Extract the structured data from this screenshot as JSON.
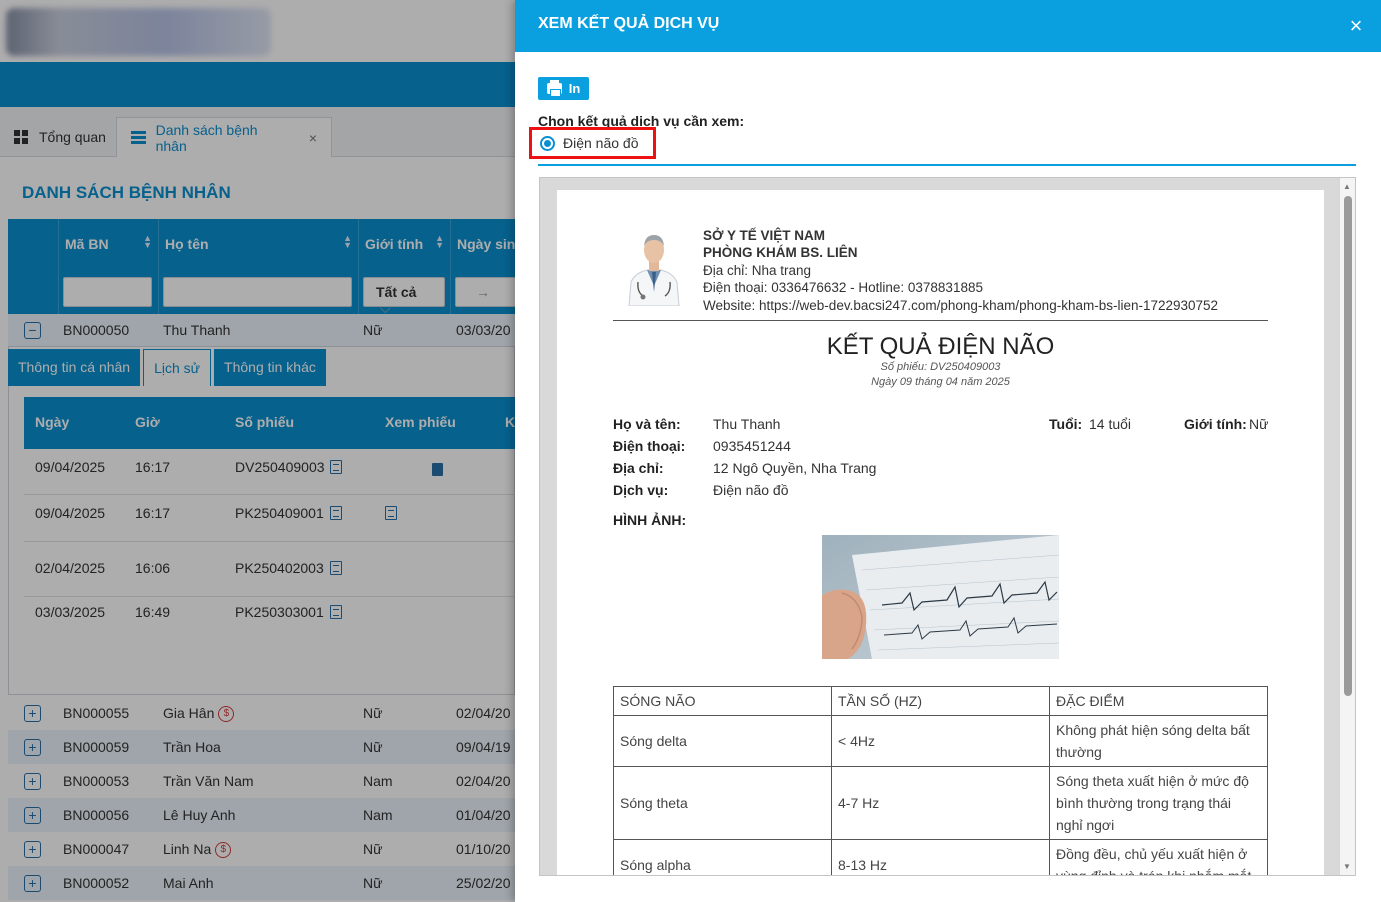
{
  "colors": {
    "primary": "#0a8fd0",
    "modal_header": "#0aa0e0",
    "highlight_border": "#e11111",
    "money_icon": "#d23c3c"
  },
  "app": {
    "tabs": [
      {
        "label": "Tổng quan",
        "icon": "dashboard-icon"
      },
      {
        "label": "Danh sách bệnh nhân",
        "icon": "list-icon",
        "close": "×"
      }
    ],
    "page_title": "DANH SÁCH BỆNH NHÂN",
    "grid": {
      "headers": [
        "Mã BN",
        "Họ tên",
        "Giới tính",
        "Ngày sinh"
      ],
      "gender_filter": "Tất cả",
      "date_filter": "→"
    },
    "expanded_row": {
      "id": "BN000050",
      "name": "Thu Thanh",
      "gender": "Nữ",
      "dob": "03/03/20"
    },
    "subtabs": [
      "Thông tin cá nhân",
      "Lịch sử",
      "Thông tin khác"
    ],
    "history": {
      "headers": [
        "Ngày",
        "Giờ",
        "Số phiếu",
        "Xem phiếu",
        "K"
      ],
      "rows": [
        {
          "date": "09/04/2025",
          "time": "16:17",
          "code": "DV250409003"
        },
        {
          "date": "09/04/2025",
          "time": "16:17",
          "code": "PK250409001"
        },
        {
          "date": "02/04/2025",
          "time": "16:06",
          "code": "PK250402003"
        },
        {
          "date": "03/03/2025",
          "time": "16:49",
          "code": "PK250303001"
        }
      ]
    },
    "patients": [
      {
        "id": "BN000055",
        "name": "Gia Hân",
        "gender": "Nữ",
        "dob": "02/04/20",
        "money": "$"
      },
      {
        "id": "BN000059",
        "name": "Trần Hoa",
        "gender": "Nữ",
        "dob": "09/04/19"
      },
      {
        "id": "BN000053",
        "name": "Trần Văn Nam",
        "gender": "Nam",
        "dob": "02/04/20"
      },
      {
        "id": "BN000056",
        "name": "Lê Huy Anh",
        "gender": "Nam",
        "dob": "01/04/20"
      },
      {
        "id": "BN000047",
        "name": "Linh Na",
        "gender": "Nữ",
        "dob": "01/10/20",
        "money": "$"
      },
      {
        "id": "BN000052",
        "name": "Mai Anh",
        "gender": "Nữ",
        "dob": "25/02/20"
      }
    ]
  },
  "modal": {
    "title": "XEM KẾT QUẢ DỊCH VỤ",
    "close": "×",
    "print_label": "In",
    "choose_label": "Chọn kết quả dịch vụ cần xem:",
    "option": "Điện não đồ",
    "report": {
      "org1": "SỞ Y TẾ VIỆT NAM",
      "org2": "PHÒNG KHÁM BS. LIÊN",
      "address": "Địa chỉ: Nha trang",
      "phone": "Điện thoại: 0336476632 - Hotline: 0378831885",
      "website": "Website: https://web-dev.bacsi247.com/phong-kham/phong-kham-bs-lien-1722930752",
      "title": "KẾT QUẢ ĐIỆN NÃO",
      "ticket": "Số phiếu: DV250409003",
      "date": "Ngày 09 tháng 04 năm 2025",
      "labels": {
        "name": "Họ và tên:",
        "age": "Tuổi:",
        "gender": "Giới tính:",
        "phone": "Điện thoại:",
        "address": "Địa chỉ:",
        "service": "Dịch vụ:",
        "images": "HÌNH ẢNH:"
      },
      "values": {
        "name": "Thu Thanh",
        "age": "14 tuổi",
        "gender": "Nữ",
        "phone": "0935451244",
        "address": "12 Ngô Quyền, Nha Trang",
        "service": "Điện não đồ"
      },
      "table_headers": [
        "SÓNG NÃO",
        "TẦN SỐ (HZ)",
        "ĐẶC ĐIỂM"
      ],
      "table_rows": [
        {
          "wave": "Sóng delta",
          "freq": "< 4Hz",
          "desc": "Không phát hiện sóng delta bất thường"
        },
        {
          "wave": "Sóng theta",
          "freq": "4-7 Hz",
          "desc": "Sóng theta xuất hiện ở mức độ bình thường trong trạng thái nghỉ ngơi"
        },
        {
          "wave": "Sóng alpha",
          "freq": "8-13 Hz",
          "desc": "Đồng đều, chủ yếu xuất hiện ở vùng đỉnh và trán khi nhắm mắt"
        }
      ]
    }
  }
}
